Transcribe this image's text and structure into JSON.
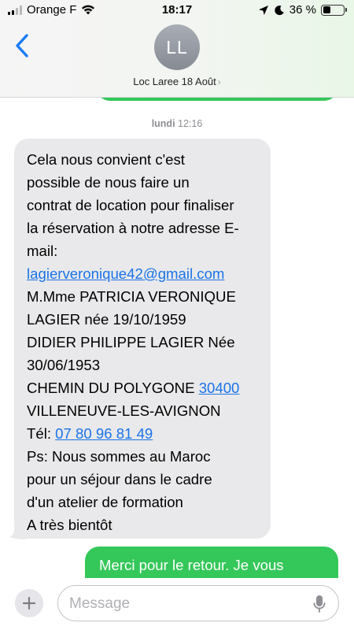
{
  "status_bar": {
    "carrier": "Orange F",
    "time": "18:17",
    "battery_percent_label": "36 %",
    "battery_level": 0.36,
    "signal_bars_active": 2
  },
  "header": {
    "avatar_initials": "LL",
    "contact_name": "Loc Laree 18 Août",
    "chevron": "›"
  },
  "conversation": {
    "timestamp_day": "lundi",
    "timestamp_time": "12:16",
    "incoming_message": {
      "lines": [
        "Cela nous convient c'est",
        "possible de nous faire un",
        "contrat de location pour finaliser",
        "la réservation à notre adresse E-",
        "mail:"
      ],
      "email_link": "lagierveronique42@gmail.com",
      "lines_after_email": [
        "M.Mme PATRICIA VERONIQUE",
        "LAGIER née 19/10/1959",
        "DIDIER PHILIPPE LAGIER Née",
        "30/06/1953"
      ],
      "address_prefix": "CHEMIN DU POLYGONE ",
      "postal_code_link": "30400",
      "city": "VILLENEUVE-LES-AVIGNON",
      "phone_prefix": "Tél: ",
      "phone_link": "07 80 96 81 49",
      "closing_lines": [
        "Ps: Nous sommes au Maroc",
        "pour un séjour dans le cadre",
        "d'un atelier de formation",
        "A très bientôt"
      ]
    },
    "outgoing_message": {
      "text": "Merci pour le retour. Je vous"
    }
  },
  "composer": {
    "placeholder": "Message",
    "value": ""
  },
  "colors": {
    "incoming_bubble": "#e9e9eb",
    "outgoing_bubble": "#34c759",
    "link": "#1a73e8",
    "accent_blue": "#1a7cf5"
  },
  "icons": [
    "back-chevron-icon",
    "wifi-icon",
    "location-arrow-icon",
    "focus-moon-icon",
    "plus-icon",
    "microphone-icon"
  ]
}
